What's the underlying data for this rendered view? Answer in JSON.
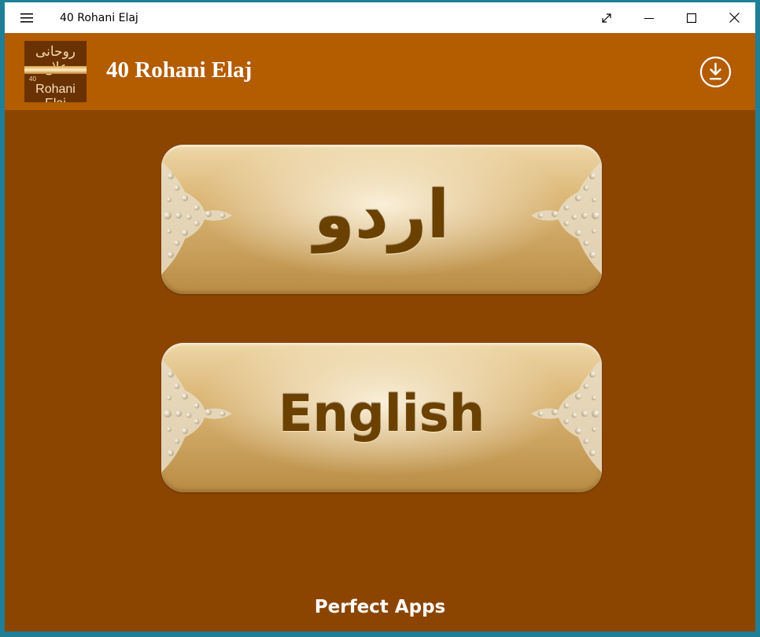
{
  "window": {
    "title": "40 Rohani Elaj",
    "controls": [
      "expand-icon",
      "minimize-icon",
      "maximize-icon",
      "close-icon"
    ]
  },
  "header": {
    "logo": {
      "urdu": "روحانی علاج",
      "number": "40",
      "name": "Rohani Elaj"
    },
    "title": "40 Rohani Elaj",
    "action_icon": "download-icon"
  },
  "languages": {
    "urdu_label": "اردو",
    "english_label": "English"
  },
  "footer": {
    "text": "Perfect Apps"
  },
  "colors": {
    "header_bg": "#b35c00",
    "content_bg": "#8b4500",
    "button_gold": "#dcb777",
    "button_text": "#6b4100"
  }
}
